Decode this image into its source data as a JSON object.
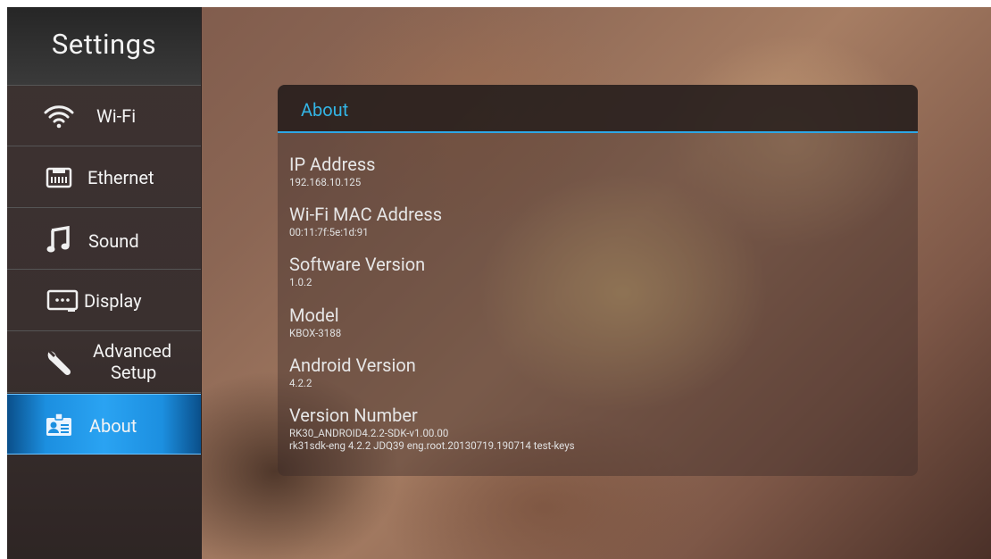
{
  "sidebar": {
    "title": "Settings",
    "items": [
      {
        "label": "Wi-Fi",
        "icon": "wifi-icon"
      },
      {
        "label": "Ethernet",
        "icon": "ethernet-icon"
      },
      {
        "label": "Sound",
        "icon": "music-note-icon"
      },
      {
        "label": "Display",
        "icon": "display-icon"
      },
      {
        "label_line1": "Advanced",
        "label_line2": "Setup",
        "icon": "wrench-icon"
      },
      {
        "label": "About",
        "icon": "id-badge-icon",
        "selected": true
      }
    ]
  },
  "panel": {
    "title": "About",
    "rows": [
      {
        "title": "IP Address",
        "value": "192.168.10.125"
      },
      {
        "title": "Wi-Fi MAC Address",
        "value": "00:11:7f:5e:1d:91"
      },
      {
        "title": "Software Version",
        "value": "1.0.2"
      },
      {
        "title": "Model",
        "value": "KBOX-3188"
      },
      {
        "title": "Android Version",
        "value": "4.2.2"
      },
      {
        "title": "Version Number",
        "value": "RK30_ANDROID4.2.2-SDK-v1.00.00",
        "value2": "rk31sdk-eng 4.2.2 JDQ39 eng.root.20130719.190714 test-keys"
      }
    ]
  },
  "colors": {
    "accent": "#33b5e5",
    "selected_bg": "#1c8fe0"
  }
}
